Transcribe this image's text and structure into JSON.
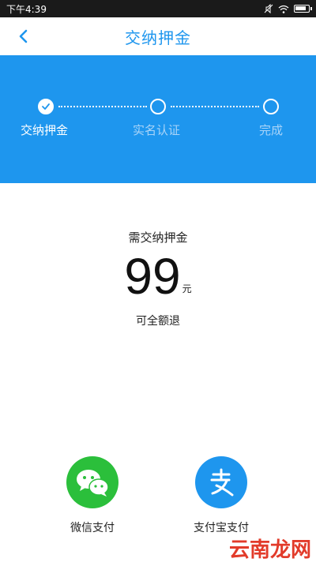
{
  "status_bar": {
    "time": "下午4:39"
  },
  "nav": {
    "title": "交纳押金"
  },
  "steps": [
    {
      "label": "交纳押金",
      "state": "done"
    },
    {
      "label": "实名认证",
      "state": "pending"
    },
    {
      "label": "完成",
      "state": "pending"
    }
  ],
  "deposit": {
    "caption": "需交纳押金",
    "amount": "99",
    "unit": "元",
    "note": "可全额退"
  },
  "payment_options": [
    {
      "label": "微信支付",
      "icon": "wechat-icon",
      "color": "#2bbf3b"
    },
    {
      "label": "支付宝支付",
      "icon": "alipay-icon",
      "color": "#1e96ee"
    }
  ],
  "watermark": {
    "text": "云南龙网"
  },
  "colors": {
    "accent": "#1e96ee",
    "wechat": "#2bbf3b",
    "watermark": "#e23b2a"
  }
}
